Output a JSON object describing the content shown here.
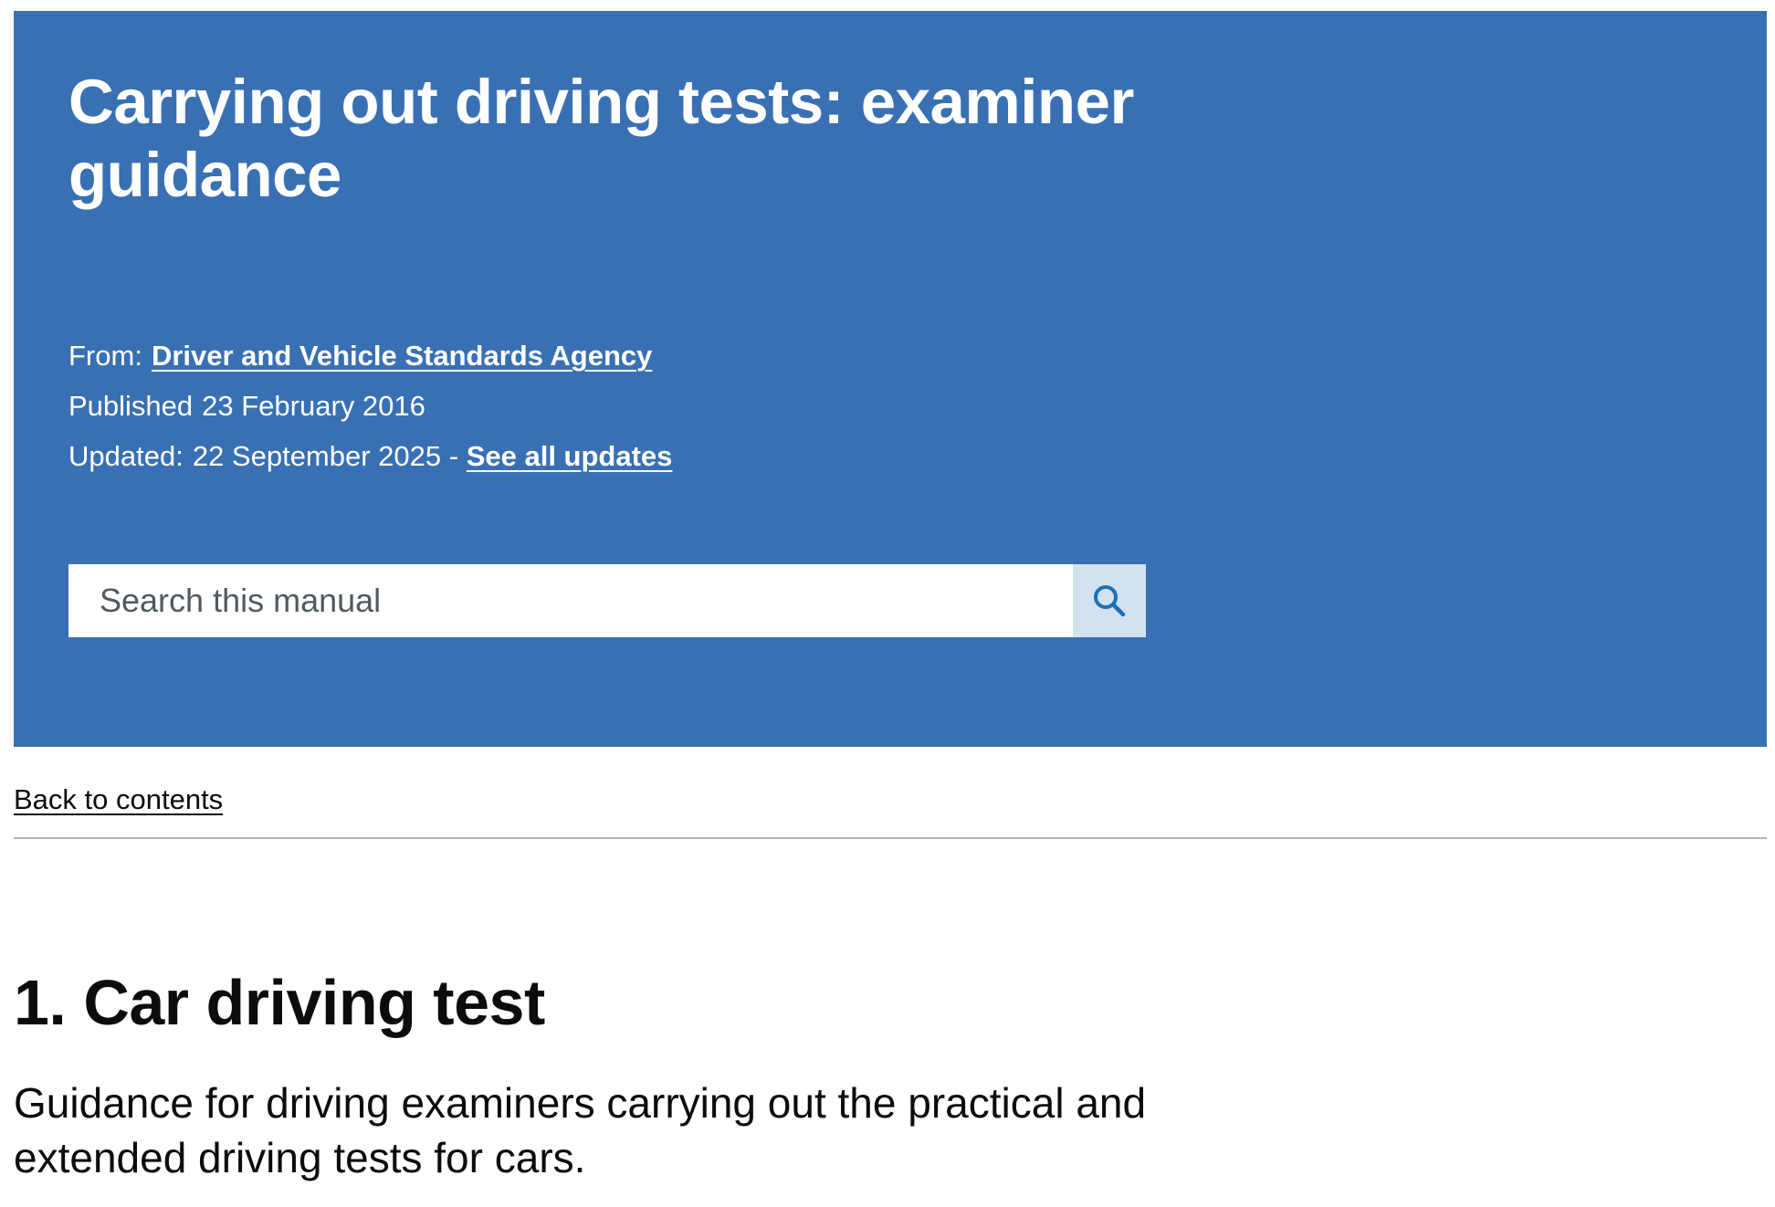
{
  "masthead": {
    "title": "Carrying out driving tests: examiner guidance",
    "from_label": "From:",
    "from_link": "Driver and Vehicle Standards Agency",
    "published_label": "Published",
    "published_date": "23 February 2016",
    "updated_label": "Updated:",
    "updated_date": "22 September 2025 -",
    "see_updates_link": "See all updates",
    "background_color": "#3970b3"
  },
  "search": {
    "placeholder": "Search this manual",
    "value": "",
    "button_icon": "search-icon",
    "button_color": "#d2e2f1"
  },
  "navigation": {
    "back_link": "Back to contents"
  },
  "section": {
    "heading": "1. Car driving test",
    "summary": "Guidance for driving examiners carrying out the practical and extended driving tests for cars."
  }
}
